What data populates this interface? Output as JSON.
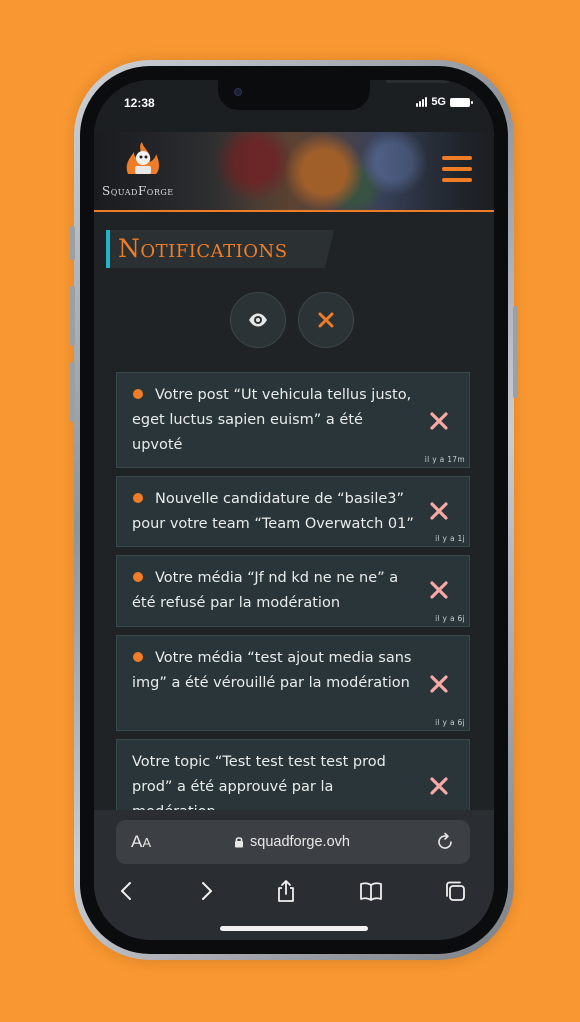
{
  "status_bar": {
    "time": "12:38",
    "network": "5G"
  },
  "header": {
    "logo_text": "SquadForge"
  },
  "page": {
    "title": "Notifications",
    "actions": {
      "mark_read": "eye-icon",
      "clear_all": "close-icon"
    }
  },
  "notifications": [
    {
      "text": "Votre post “Ut vehicula tellus justo, eget luctus sapien euism” a été upvoté",
      "time": "il y a 17m",
      "unread": true
    },
    {
      "text": "Nouvelle candidature de “basile3” pour votre team “Team Overwatch 01”",
      "time": "il y a 1j",
      "unread": true
    },
    {
      "text": "Votre média “Jf nd kd ne ne ne” a été refusé par la modération",
      "time": "il y a 6j",
      "unread": true
    },
    {
      "text": "Votre média “test ajout media sans img” a été vérouillé par la modération",
      "time": "il y a 6j",
      "unread": true
    },
    {
      "text": "Votre topic “Test test test test prod prod” a été approuvé par la modération",
      "time": "",
      "unread": false
    }
  ],
  "browser": {
    "aa_label": "A",
    "aa_small": "A",
    "url": "squadforge.ovh"
  },
  "colors": {
    "accent": "#f07c26",
    "teal": "#20b6c9",
    "close_x": "#f6a9a5",
    "card_bg": "#293538",
    "page_bg": "#1f2326"
  }
}
